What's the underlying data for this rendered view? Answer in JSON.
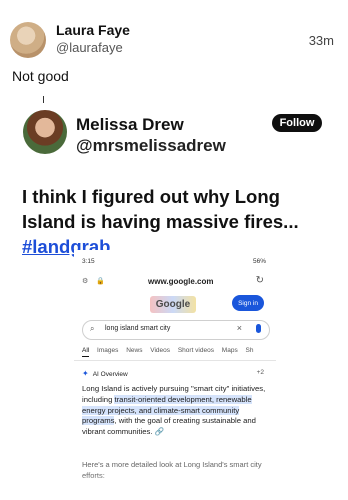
{
  "post": {
    "author_name": "Laura Faye",
    "author_handle": "@laurafaye",
    "time": "33m",
    "text": "Not good"
  },
  "embedded": {
    "author_name": "Melissa Drew",
    "author_handle": "@mrsmelissadrew",
    "follow_label": "Follow",
    "headline_text": "I think I figured out why Long Island is having massive fires... ",
    "hashtag": "#landgrab"
  },
  "screenshot": {
    "status_time": "3:15",
    "status_right": "56%",
    "url": "www.google.com",
    "doodle": "Google",
    "signin": "Sign in",
    "search_query": "long island smart city",
    "tabs": [
      "All",
      "Images",
      "News",
      "Videos",
      "Short videos",
      "Maps",
      "Sh"
    ],
    "ai_overview_label": "AI Overview",
    "ai_count": "+2",
    "body_pre": "Long Island is actively pursuing \"smart city\" initiatives, including ",
    "body_highlight": "transit-oriented development, renewable energy projects, and climate-smart community programs",
    "body_post": ", with the goal of creating sustainable and vibrant communities.",
    "more_text": "Here's a more detailed look at Long Island's smart city efforts:"
  },
  "icons": {
    "brand_accent": "#1a56db",
    "hashtag_color": "#1d4ed8"
  }
}
